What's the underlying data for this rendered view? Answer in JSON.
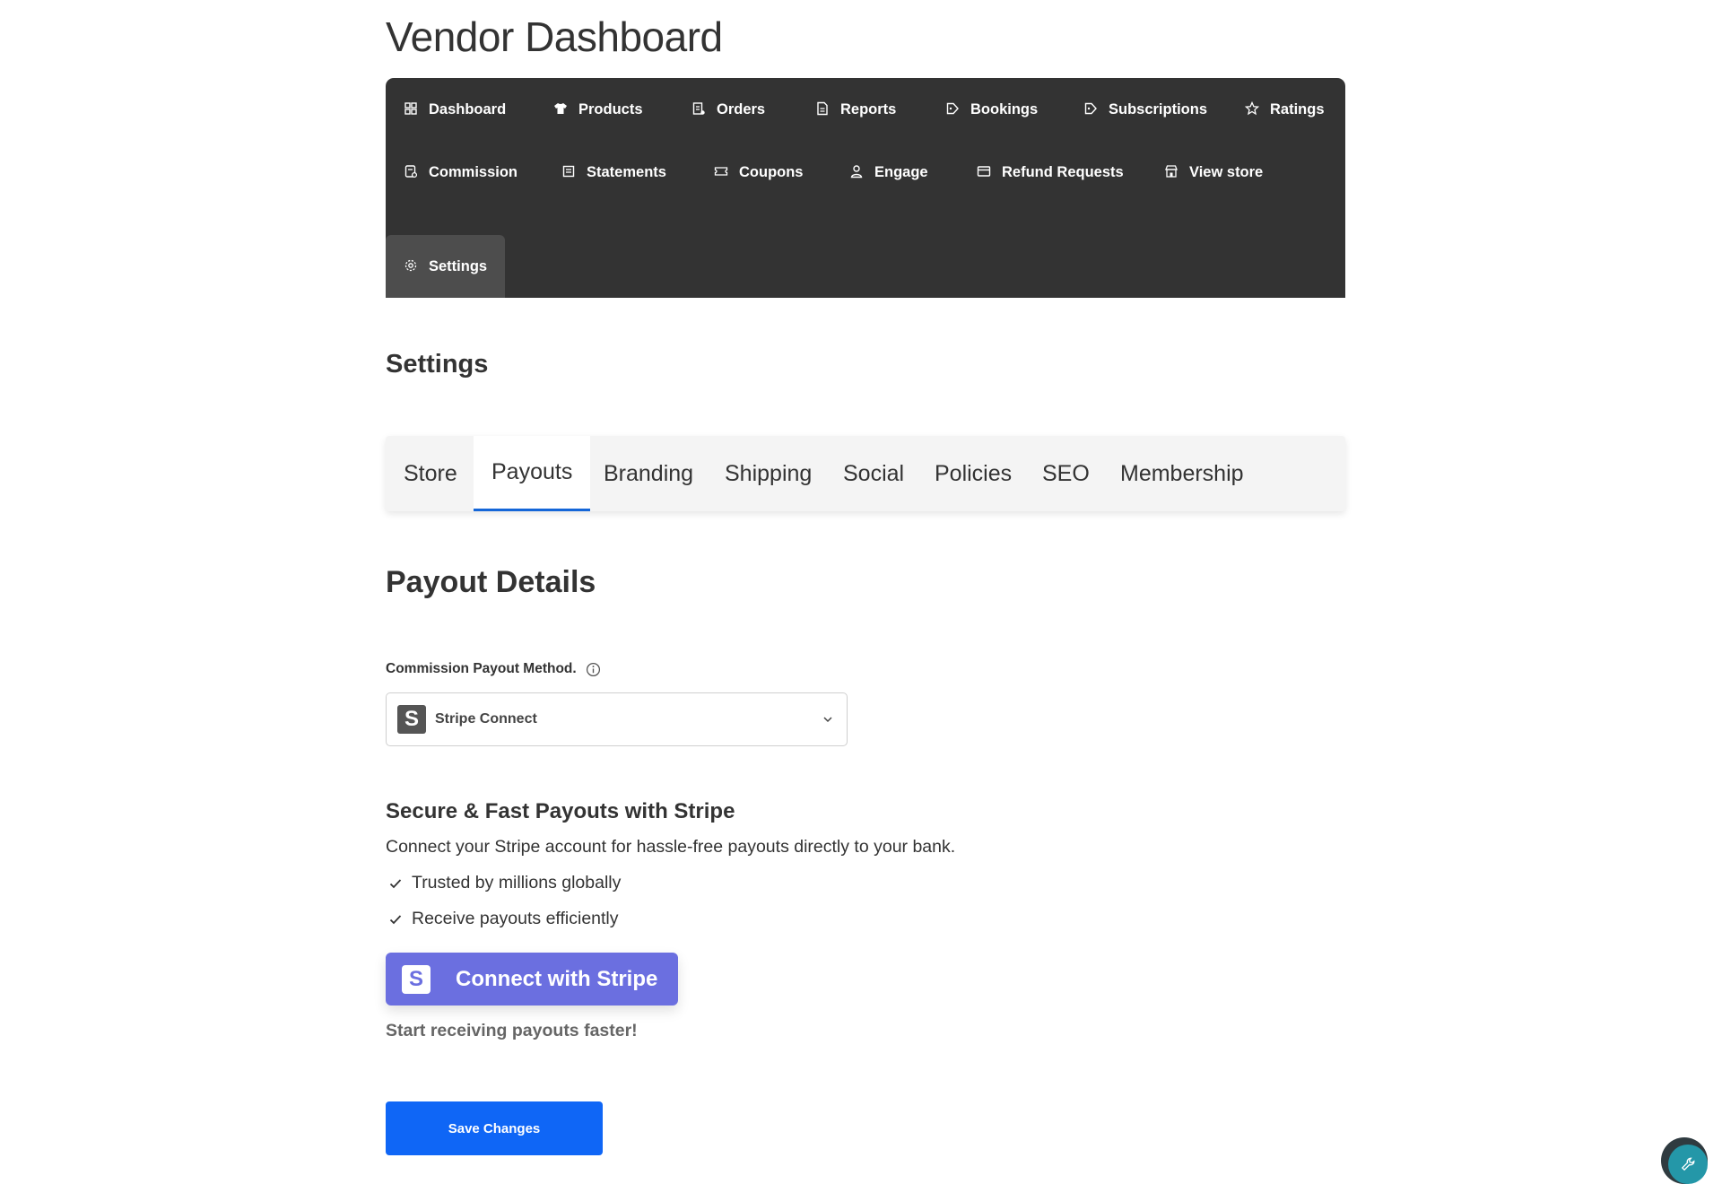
{
  "page_title": "Vendor Dashboard",
  "nav": {
    "items": [
      {
        "label": "Dashboard",
        "icon": "grid-icon"
      },
      {
        "label": "Products",
        "icon": "tshirt-icon"
      },
      {
        "label": "Orders",
        "icon": "order-icon"
      },
      {
        "label": "Reports",
        "icon": "report-icon"
      },
      {
        "label": "Bookings",
        "icon": "tag-icon"
      },
      {
        "label": "Subscriptions",
        "icon": "tag-icon"
      },
      {
        "label": "Ratings",
        "icon": "star-icon"
      },
      {
        "label": "Commission",
        "icon": "commission-icon"
      },
      {
        "label": "Statements",
        "icon": "statement-icon"
      },
      {
        "label": "Coupons",
        "icon": "ticket-icon"
      },
      {
        "label": "Engage",
        "icon": "user-icon"
      },
      {
        "label": "Refund Requests",
        "icon": "card-icon"
      },
      {
        "label": "View store",
        "icon": "store-icon"
      },
      {
        "label": "Settings",
        "icon": "gear-icon"
      }
    ],
    "active": "Settings"
  },
  "section_title": "Settings",
  "tabs": {
    "items": [
      "Store",
      "Payouts",
      "Branding",
      "Shipping",
      "Social",
      "Policies",
      "SEO",
      "Membership"
    ],
    "active": "Payouts",
    "accent_color": "#1466d8"
  },
  "payout": {
    "heading": "Payout Details",
    "method_label": "Commission Payout Method.",
    "method_value": "Stripe Connect",
    "method_logo_letter": "S"
  },
  "stripe": {
    "title": "Secure & Fast Payouts with Stripe",
    "description": "Connect your Stripe account for hassle-free payouts directly to your bank.",
    "benefits": [
      "Trusted by millions globally",
      "Receive payouts efficiently"
    ],
    "button_label": "Connect with Stripe",
    "button_logo_letter": "S",
    "button_color": "#6b6fe0",
    "tagline": "Start receiving payouts faster!"
  },
  "save_label": "Save Changes",
  "save_color": "#0f66f6"
}
